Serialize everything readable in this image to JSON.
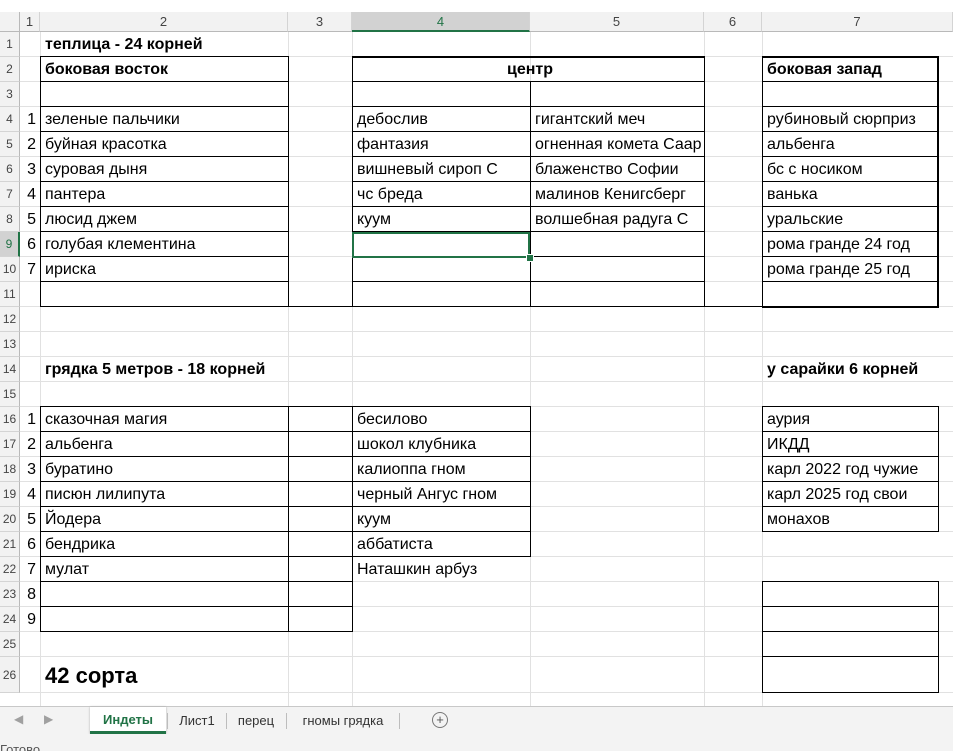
{
  "column_headers": [
    "1",
    "2",
    "3",
    "4",
    "5",
    "6",
    "7"
  ],
  "row_headers": [
    "1",
    "2",
    "3",
    "4",
    "5",
    "6",
    "7",
    "8",
    "9",
    "10",
    "11",
    "12",
    "13",
    "14",
    "15",
    "16",
    "17",
    "18",
    "19",
    "20",
    "21",
    "22",
    "23",
    "24",
    "25",
    "26"
  ],
  "cells": {
    "greenhouse_title": "теплица - 24 корней",
    "east_side": "боковая восток",
    "center": "центр",
    "west_side": "боковая запад",
    "east_nums": [
      "1",
      "2",
      "3",
      "4",
      "5",
      "6",
      "7"
    ],
    "east_items": [
      "зеленые пальчики",
      "буйная красотка",
      "суровая дыня",
      "пантера",
      "люсид джем",
      "голубая клементина",
      "ириска"
    ],
    "center_col4": [
      "дебослив",
      "фантазия",
      "вишневый сироп С",
      "чс бреда",
      "куум"
    ],
    "center_col5": [
      "гигантский меч",
      "огненная комета Саар",
      "блаженство Софии",
      "малинов Кенигсберг",
      "волшебная радуга С"
    ],
    "west_items": [
      "рубиновый сюрприз",
      "альбенга",
      "бс с носиком",
      "ванька",
      "уральские",
      "рома гранде 24 год",
      "рома гранде 25 год"
    ],
    "bed_title": "грядка 5 метров - 18 корней",
    "shed_title": "у сарайки 6 корней",
    "bed_nums": [
      "1",
      "2",
      "3",
      "4",
      "5",
      "6",
      "7",
      "8",
      "9"
    ],
    "bed_items": [
      "сказочная магия",
      "альбенга",
      "буратино",
      "писюн лилипута",
      "Йодера",
      "бендрика",
      "мулат"
    ],
    "bed_col4": [
      "бесилово",
      "шокол клубника",
      "калиоппа гном",
      "черный Ангус гном",
      "куум",
      "аббатиста",
      "Наташкин арбуз"
    ],
    "shed_items": [
      "аурия",
      "ИКДД",
      "карл 2022 год чужие",
      "карл 2025 год свои",
      "монахов"
    ],
    "total": "42 сорта"
  },
  "tabs": [
    "Индеты",
    "Лист1",
    "перец",
    "гномы грядка"
  ],
  "active_tab": "Индеты",
  "status": "Готово",
  "accent_color": "#217346"
}
